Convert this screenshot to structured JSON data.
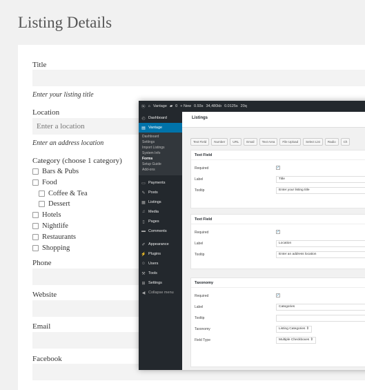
{
  "page": {
    "title": "Listing Details"
  },
  "form": {
    "title_label": "Title",
    "title_hint": "Enter your listing title",
    "location_label": "Location",
    "location_placeholder": "Enter a location",
    "location_hint": "Enter an address location",
    "category_label": "Category (choose 1 category)",
    "categories": [
      {
        "label": "Bars & Pubs",
        "level": 0
      },
      {
        "label": "Food",
        "level": 0
      },
      {
        "label": "Coffee & Tea",
        "level": 1
      },
      {
        "label": "Dessert",
        "level": 1
      },
      {
        "label": "Hotels",
        "level": 0
      },
      {
        "label": "Nightlife",
        "level": 0
      },
      {
        "label": "Restaurants",
        "level": 0
      },
      {
        "label": "Shopping",
        "level": 0
      }
    ],
    "phone_label": "Phone",
    "website_label": "Website",
    "email_label": "Email",
    "facebook_label": "Facebook"
  },
  "admin": {
    "adminbar": [
      "Vantage",
      "0",
      "+ New",
      "0.93s",
      "34,480kb",
      "0.0125s",
      "20q"
    ],
    "menu": {
      "dashboard": "Dashboard",
      "vantage": "Vantage",
      "submenu": [
        "Dashboard",
        "Settings",
        "Import Listings",
        "System Info",
        "Forms",
        "Setup Guide",
        "Add-ons"
      ],
      "current_sub": "Forms",
      "items": [
        "Payments",
        "Posts",
        "Listings",
        "Media",
        "Pages",
        "Comments",
        "Appearance",
        "Plugins",
        "Users",
        "Tools",
        "Settings",
        "Collapse menu"
      ]
    },
    "tab": "Listings",
    "field_buttons": [
      "Text Field",
      "Number",
      "URL",
      "Email",
      "Text Area",
      "File Upload",
      "Select List",
      "Radio",
      "Ch"
    ],
    "panels": [
      {
        "title": "Text Field",
        "required_label": "Required",
        "required_check": "✓",
        "label_label": "Label",
        "label_value": "Title",
        "tooltip_label": "Tooltip",
        "tooltip_value": "Enter your listing title"
      },
      {
        "title": "Text Field",
        "required_label": "Required",
        "required_check": "✓",
        "label_label": "Label",
        "label_value": "Location",
        "tooltip_label": "Tooltip",
        "tooltip_value": "Enter an address location"
      },
      {
        "title": "Taxonomy",
        "required_label": "Required",
        "required_check": "✓",
        "label_label": "Label",
        "label_value": "Categories",
        "tooltip_label": "Tooltip",
        "tooltip_value": "",
        "taxonomy_label": "Taxonomy",
        "taxonomy_value": "Listing Categories ⇕",
        "fieldtype_label": "Field Type",
        "fieldtype_value": "Multiple Checkboxes ⇕"
      }
    ]
  }
}
